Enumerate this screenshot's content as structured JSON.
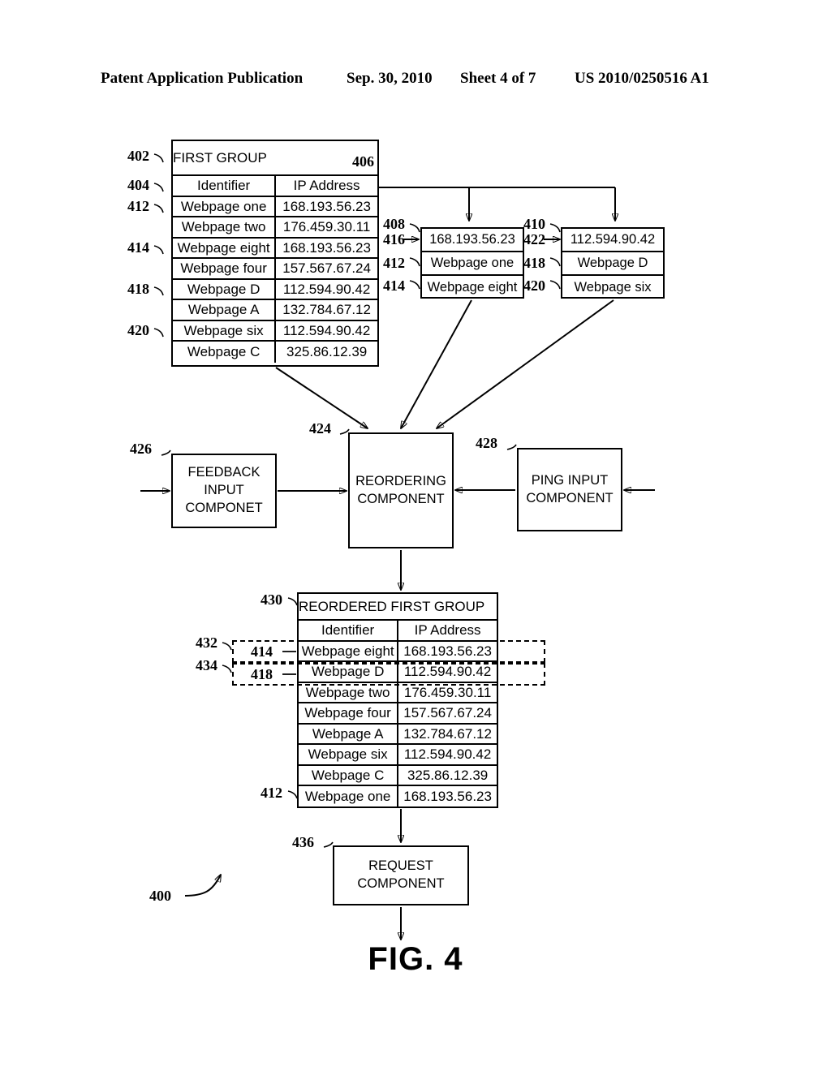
{
  "header": {
    "title": "Patent Application Publication",
    "date": "Sep. 30, 2010",
    "sheet": "Sheet 4 of 7",
    "number": "US 2010/0250516 A1"
  },
  "figure": {
    "caption": "FIG. 4",
    "system_ref": "400"
  },
  "first_group": {
    "ref": "402",
    "title": "FIRST GROUP",
    "header_ref": "404",
    "ip_column_ref": "406",
    "columns": [
      "Identifier",
      "IP Address"
    ],
    "rows": [
      {
        "ref": "412",
        "identifier": "Webpage one",
        "ip": "168.193.56.23"
      },
      {
        "ref": "",
        "identifier": "Webpage two",
        "ip": "176.459.30.11"
      },
      {
        "ref": "414",
        "identifier": "Webpage eight",
        "ip": "168.193.56.23"
      },
      {
        "ref": "",
        "identifier": "Webpage four",
        "ip": "157.567.67.24"
      },
      {
        "ref": "418",
        "identifier": "Webpage D",
        "ip": "112.594.90.42"
      },
      {
        "ref": "",
        "identifier": "Webpage A",
        "ip": "132.784.67.12"
      },
      {
        "ref": "420",
        "identifier": "Webpage six",
        "ip": "112.594.90.42"
      },
      {
        "ref": "",
        "identifier": "Webpage C",
        "ip": "325.86.12.39"
      }
    ]
  },
  "subgroup_408": {
    "ref": "408",
    "ip_ref": "416",
    "ip": "168.193.56.23",
    "members": [
      {
        "ref": "412",
        "identifier": "Webpage one"
      },
      {
        "ref": "414",
        "identifier": "Webpage eight"
      }
    ]
  },
  "subgroup_410": {
    "ref": "410",
    "ip_ref": "422",
    "ip": "112.594.90.42",
    "members": [
      {
        "ref": "418",
        "identifier": "Webpage D"
      },
      {
        "ref": "420",
        "identifier": "Webpage six"
      }
    ]
  },
  "components": {
    "feedback": {
      "ref": "426",
      "label": "FEEDBACK\nINPUT\nCOMPONET"
    },
    "reordering": {
      "ref": "424",
      "label": "REORDERING\nCOMPONENT"
    },
    "ping": {
      "ref": "428",
      "label": "PING INPUT\nCOMPONENT"
    },
    "request": {
      "ref": "436",
      "label": "REQUEST\nCOMPONENT"
    }
  },
  "reordered_group": {
    "ref": "430",
    "title": "REORDERED FIRST GROUP",
    "columns": [
      "Identifier",
      "IP Address"
    ],
    "highlight_refs": {
      "first": "432",
      "second": "434"
    },
    "rows": [
      {
        "ref": "414",
        "identifier": "Webpage eight",
        "ip": "168.193.56.23"
      },
      {
        "ref": "418",
        "identifier": "Webpage D",
        "ip": "112.594.90.42"
      },
      {
        "ref": "",
        "identifier": "Webpage two",
        "ip": "176.459.30.11"
      },
      {
        "ref": "",
        "identifier": "Webpage four",
        "ip": "157.567.67.24"
      },
      {
        "ref": "",
        "identifier": "Webpage A",
        "ip": "132.784.67.12"
      },
      {
        "ref": "",
        "identifier": "Webpage six",
        "ip": "112.594.90.42"
      },
      {
        "ref": "",
        "identifier": "Webpage C",
        "ip": "325.86.12.39"
      },
      {
        "ref": "412",
        "identifier": "Webpage one",
        "ip": "168.193.56.23"
      }
    ]
  }
}
